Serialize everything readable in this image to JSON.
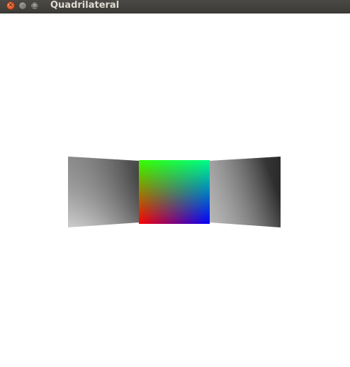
{
  "window": {
    "title": "Quadrilateral",
    "buttons": {
      "close_icon": "close-icon",
      "minimize_icon": "minimize-icon",
      "maximize_icon": "maximize-icon"
    }
  },
  "scene": {
    "center_quad_colors": {
      "top_left": "#33ff00",
      "top_right": "#00ff88",
      "bottom_left": "#ff0000",
      "bottom_right": "#0000ff"
    },
    "side_quad_colors": {
      "light": "#ffffff",
      "dark": "#111111"
    }
  }
}
